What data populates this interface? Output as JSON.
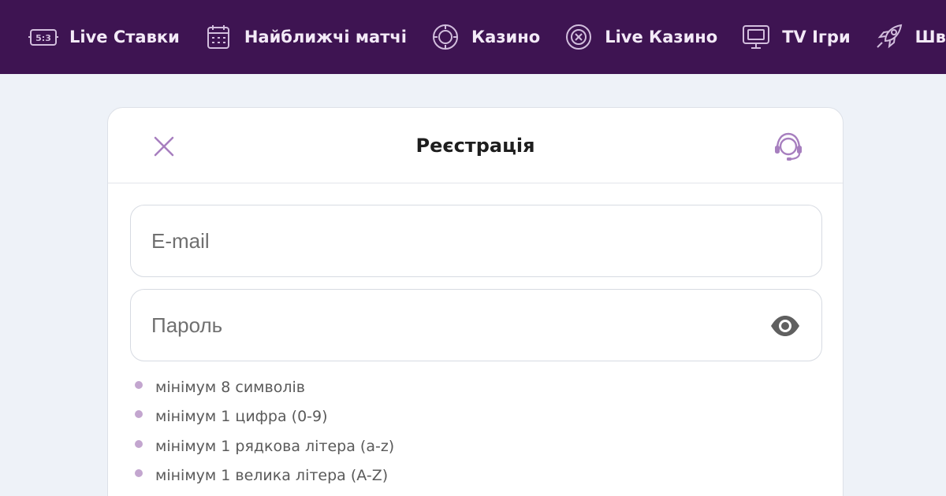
{
  "nav": {
    "items": [
      {
        "label": "Live Ставки",
        "icon": "scoreboard-icon"
      },
      {
        "label": "Найближчі матчі",
        "icon": "calendar-icon"
      },
      {
        "label": "Казино",
        "icon": "casino-chip-icon"
      },
      {
        "label": "Live Казино",
        "icon": "roulette-icon"
      },
      {
        "label": "TV Ігри",
        "icon": "tv-icon"
      },
      {
        "label": "Швидкі Ігри",
        "icon": "rocket-icon"
      }
    ],
    "scoreboard_text": "5:3"
  },
  "modal": {
    "title": "Реєстрація",
    "close_icon": "close-icon",
    "support_icon": "support-headset-icon",
    "email": {
      "placeholder": "E-mail",
      "value": ""
    },
    "password": {
      "placeholder": "Пароль",
      "value": "",
      "toggle_icon": "eye-icon"
    },
    "rules": [
      "мінімум 8 символів",
      "мінімум 1 цифра (0-9)",
      "мінімум 1 рядкова літера (a-z)",
      "мінімум 1 велика літера (A-Z)"
    ]
  },
  "colors": {
    "nav_bg": "#3e1452",
    "nav_text": "#f3eaf7",
    "accent": "#a77fbf",
    "rule_dot": "#c3a6cf",
    "page_bg": "#eef2f8"
  }
}
